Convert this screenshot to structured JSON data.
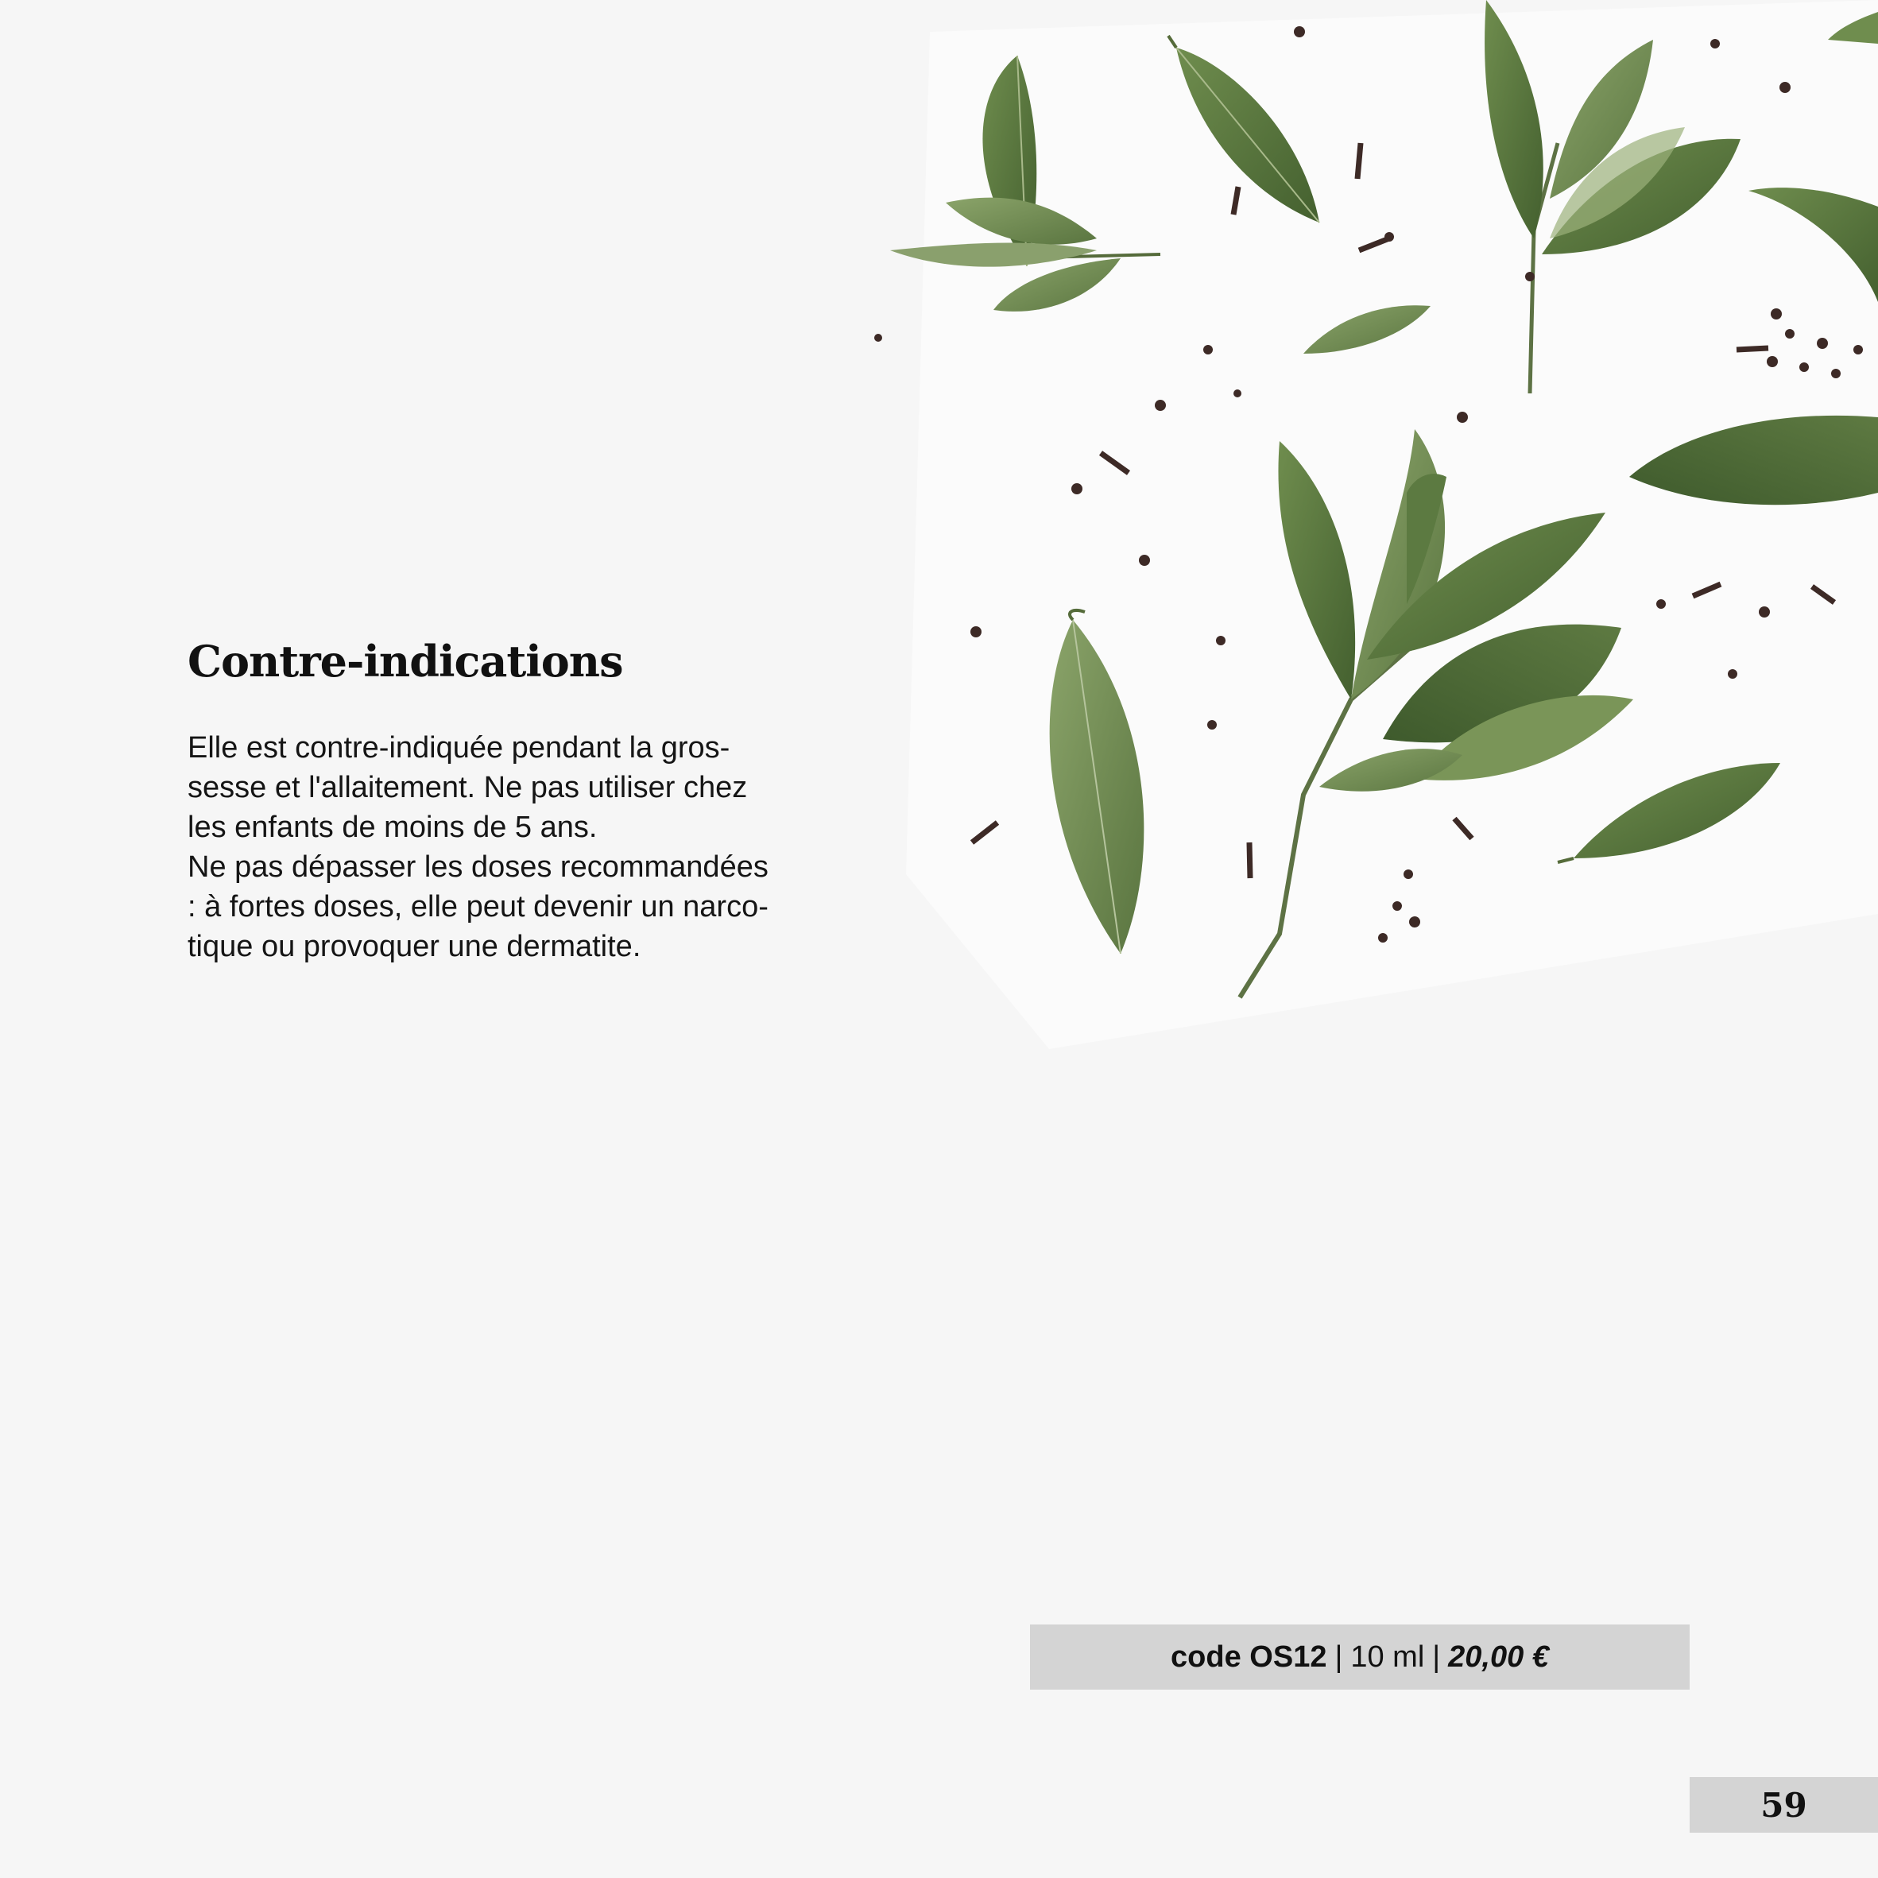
{
  "section": {
    "title": "Contre-indications",
    "paragraph_lines": [
      "Elle est contre-indiquée pendant la gros-",
      "sesse et l'allaitement. Ne pas utiliser chez",
      "les enfants de moins de 5 ans.",
      "Ne pas dépasser les doses recommandées",
      ": à fortes doses, elle peut devenir un narco-",
      "tique ou provoquer une dermatite."
    ]
  },
  "product": {
    "code": "code OS12",
    "volume": "10 ml",
    "price": "20,00 €",
    "separator": "|"
  },
  "page_number": "59",
  "colors": {
    "background": "#f6f6f6",
    "leaf_dark": "#4f6b3a",
    "leaf_light": "#7d9a5c",
    "clove": "#3d2a26",
    "bar_gray": "#d4d4d4"
  }
}
